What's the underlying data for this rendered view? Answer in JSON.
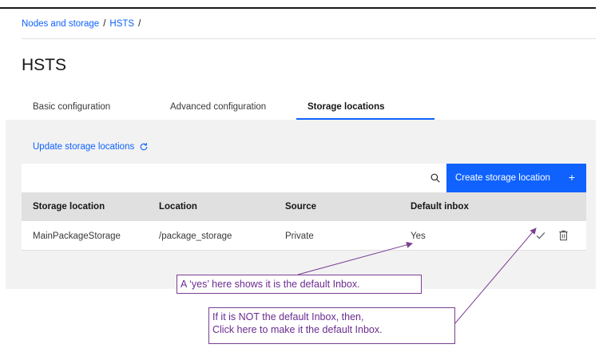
{
  "breadcrumb": {
    "items": [
      "Nodes and storage",
      "HSTS"
    ],
    "separator": "/"
  },
  "page": {
    "title": "HSTS"
  },
  "tabs": [
    {
      "label": "Basic configuration"
    },
    {
      "label": "Advanced configuration"
    },
    {
      "label": "Storage locations",
      "active": true
    }
  ],
  "actions": {
    "update_label": "Update storage locations",
    "create_label": "Create storage location",
    "create_icon": "plus-icon",
    "search_icon": "search-icon",
    "refresh_icon": "refresh-icon"
  },
  "table": {
    "headers": [
      "Storage location",
      "Location",
      "Source",
      "Default inbox"
    ],
    "rows": [
      {
        "storage_location": "MainPackageStorage",
        "location": "/package_storage",
        "source": "Private",
        "default_inbox": "Yes"
      }
    ],
    "row_icons": [
      "checkmark-icon",
      "trash-icon"
    ]
  },
  "annotations": {
    "callout1": "A ‘yes’ here shows it is the default Inbox.",
    "callout2_line1": "If it is NOT the default Inbox, then,",
    "callout2_line2": "Click here to make it the default Inbox."
  },
  "colors": {
    "primary": "#0f62fe",
    "annotation": "#6a2c8f",
    "panel_bg": "#f2f2f2",
    "header_bg": "#e0e0e0"
  }
}
